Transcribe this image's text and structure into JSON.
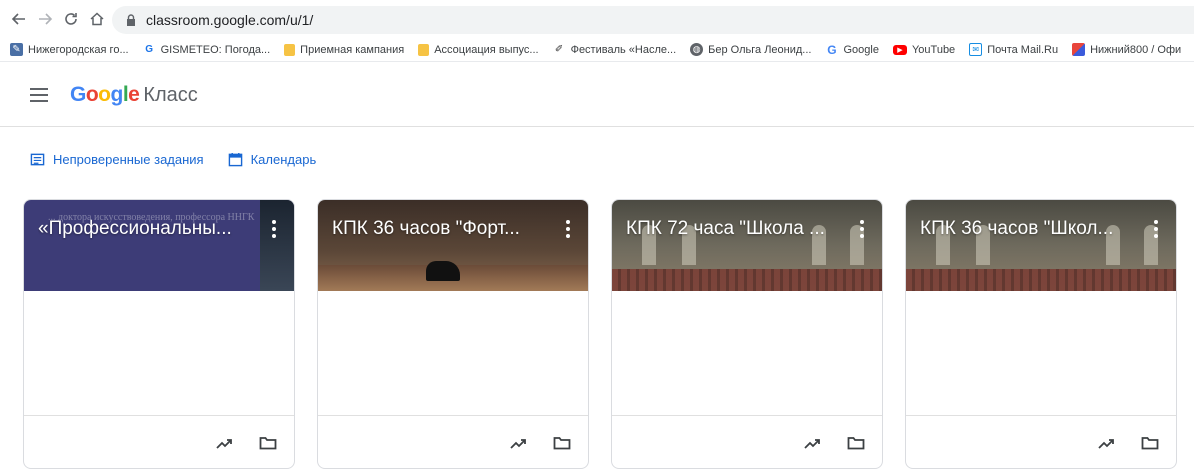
{
  "browser": {
    "url": "classroom.google.com/u/1/",
    "bookmarks": [
      {
        "label": "Нижегородская го...",
        "icon": "edit-square-icon",
        "color": "#4a6fa5"
      },
      {
        "label": "GISMETEO: Погода...",
        "icon": "gismeteo-icon",
        "color": "#1a73e8"
      },
      {
        "label": "Приемная кампания",
        "icon": "folder-icon",
        "color": "#f6c344"
      },
      {
        "label": "Ассоциация выпус...",
        "icon": "folder-icon",
        "color": "#f6c344"
      },
      {
        "label": "Фестиваль «Насле...",
        "icon": "brush-icon",
        "color": "#333333"
      },
      {
        "label": "Бер Ольга Леонид...",
        "icon": "globe-icon",
        "color": "#5f6368"
      },
      {
        "label": "Google",
        "icon": "google-icon",
        "color": "#4285f4"
      },
      {
        "label": "YouTube",
        "icon": "youtube-icon",
        "color": "#ff0000"
      },
      {
        "label": "Почта Mail.Ru",
        "icon": "mail-icon",
        "color": "#168de2"
      },
      {
        "label": "Нижний800 / Офи",
        "icon": "flag-icon",
        "color": "#e8453c"
      }
    ]
  },
  "header": {
    "logo_google": "Google",
    "logo_product": "Класс"
  },
  "links": {
    "unreviewed": "Непроверенные задания",
    "calendar": "Календарь"
  },
  "cards": [
    {
      "title": "«Профессиональны...",
      "deco": "... доктора искусствоведения, профессора ННГК"
    },
    {
      "title": "КПК 36 часов \"Форт..."
    },
    {
      "title": "КПК 72 часа \"Школа ..."
    },
    {
      "title": "КПК 36 часов \"Школ..."
    }
  ],
  "colors": {
    "accent": "#1967d2",
    "card1": "#3d3c77"
  }
}
